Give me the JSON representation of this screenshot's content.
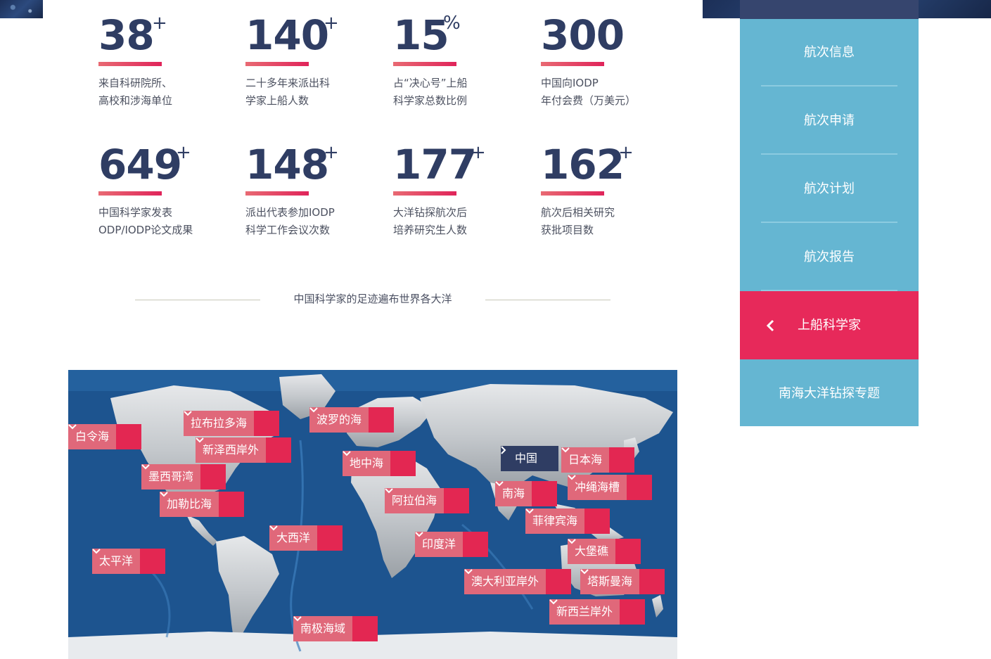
{
  "stats": [
    {
      "number": "38",
      "suffix": "+",
      "line1": "来自科研院所、",
      "line2": "高校和涉海单位"
    },
    {
      "number": "140",
      "suffix": "+",
      "line1": "二十多年来派出科",
      "line2": "学家上船人数"
    },
    {
      "number": "15",
      "suffix": "%",
      "line1": "占“决心号”上船",
      "line2": "科学家总数比例"
    },
    {
      "number": "300",
      "suffix": "",
      "line1": "中国向IODP",
      "line2": "年付会费（万美元）"
    },
    {
      "number": "649",
      "suffix": "+",
      "line1": "中国科学家发表",
      "line2": "ODP/IODP论文成果"
    },
    {
      "number": "148",
      "suffix": "+",
      "line1": "派出代表参加IODP",
      "line2": "科学工作会议次数"
    },
    {
      "number": "177",
      "suffix": "+",
      "line1": "大洋钻探航次后",
      "line2": "培养研究生人数"
    },
    {
      "number": "162",
      "suffix": "+",
      "line1": "航次后相关研究",
      "line2": "获批项目数"
    }
  ],
  "section_heading": "中国科学家的足迹遍布世界各大洋",
  "map_tags": {
    "bering": "白令海",
    "labrador": "拉布拉多海",
    "baltic": "波罗的海",
    "newfoundland": "新泽西岸外",
    "mediterranean": "地中海",
    "china": "中国",
    "japan_sea": "日本海",
    "gulf_mexico": "墨西哥湾",
    "okinawa": "冲绳海槽",
    "south_sea": "南海",
    "caribbean": "加勒比海",
    "arabian": "阿拉伯海",
    "philippine": "菲律宾海",
    "atlantic": "大西洋",
    "indian": "印度洋",
    "great_barrier": "大堡礁",
    "pacific": "太平洋",
    "australia_off": "澳大利亚岸外",
    "tasman": "塔斯曼海",
    "new_zealand": "新西兰岸外",
    "antarctic": "南极海域"
  },
  "sidebar": {
    "items": [
      {
        "label": "航次信息"
      },
      {
        "label": "航次申请"
      },
      {
        "label": "航次计划"
      },
      {
        "label": "航次报告"
      },
      {
        "label": "上船科学家",
        "active": true
      },
      {
        "label": "南海大洋钻探专题"
      }
    ]
  },
  "colors": {
    "accent": "#e7295a",
    "navy": "#2f3d63",
    "sidebar": "#65b6d2",
    "tag": "#e0687a"
  }
}
